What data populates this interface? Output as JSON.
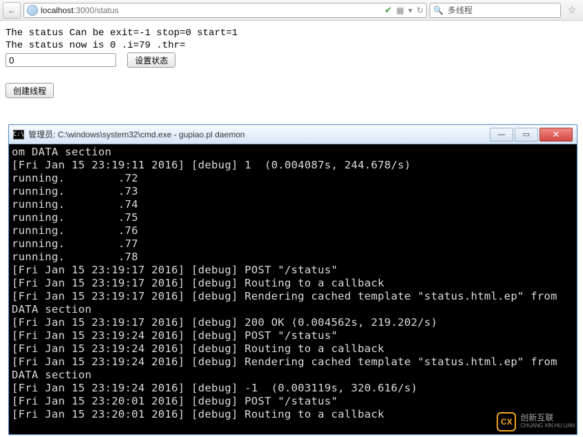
{
  "toolbar": {
    "back_glyph": "←",
    "url_prefix": "localhost",
    "url_suffix": ":3000/status",
    "shield_glyph": "✔",
    "qr_glyph": "▦",
    "dropdown_glyph": "▾",
    "reload_glyph": "↻",
    "search_glyph": "🔍",
    "search_placeholder": "多线程",
    "star_glyph": "☆"
  },
  "page": {
    "line1": "The status Can be exit=-1 stop=0 start=1",
    "line2": "The status now is 0 .i=79 .thr=",
    "input_value": "0",
    "btn_set": "设置状态",
    "btn_create": "创建线程"
  },
  "console": {
    "icon_text": "C:\\",
    "title": "管理员: C:\\windows\\system32\\cmd.exe - gupiao.pl  daemon",
    "min_glyph": "—",
    "max_glyph": "▭",
    "close_glyph": "✕",
    "lines": [
      "om DATA section",
      "[Fri Jan 15 23:19:11 2016] [debug] 1  (0.004087s, 244.678/s)",
      "running.        .72",
      "running.        .73",
      "running.        .74",
      "running.        .75",
      "running.        .76",
      "running.        .77",
      "running.        .78",
      "[Fri Jan 15 23:19:17 2016] [debug] POST \"/status\"",
      "[Fri Jan 15 23:19:17 2016] [debug] Routing to a callback",
      "[Fri Jan 15 23:19:17 2016] [debug] Rendering cached template \"status.html.ep\" from DATA section",
      "[Fri Jan 15 23:19:17 2016] [debug] 200 OK (0.004562s, 219.202/s)",
      "[Fri Jan 15 23:19:24 2016] [debug] POST \"/status\"",
      "[Fri Jan 15 23:19:24 2016] [debug] Routing to a callback",
      "[Fri Jan 15 23:19:24 2016] [debug] Rendering cached template \"status.html.ep\" from DATA section",
      "[Fri Jan 15 23:19:24 2016] [debug] -1  (0.003119s, 320.616/s)",
      "[Fri Jan 15 23:20:01 2016] [debug] POST \"/status\"",
      "[Fri Jan 15 23:20:01 2016] [debug] Routing to a callback"
    ]
  },
  "watermark": {
    "badge": "CX",
    "cn": "创新互联",
    "py": "CHUANG XIN HU LIAN"
  }
}
